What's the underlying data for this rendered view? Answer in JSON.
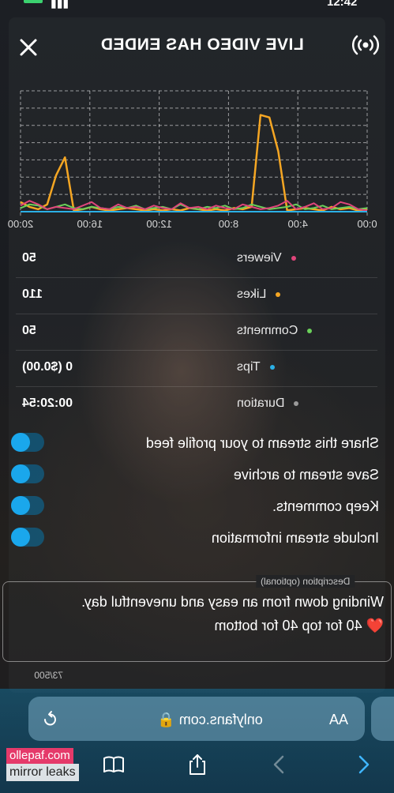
{
  "status_bar": {
    "time": "12:42"
  },
  "header": {
    "title": "LIVE VIDEO HAS ENDED"
  },
  "chart_data": {
    "type": "line",
    "x": [
      "0:00",
      "4:00",
      "8:00",
      "12:00",
      "16:00",
      "20:00"
    ],
    "series": [
      {
        "color": "#f5a623",
        "values": [
          2,
          1,
          3,
          2,
          4,
          1,
          2,
          3,
          2,
          1,
          50,
          78,
          80,
          4,
          2,
          3,
          1,
          2,
          1,
          2,
          3,
          1,
          2,
          1,
          2,
          1,
          2,
          3,
          2,
          1,
          2,
          4,
          2,
          1,
          45,
          30,
          6,
          2,
          4,
          8
        ]
      },
      {
        "color": "#6ad05a",
        "values": [
          3,
          2,
          4,
          3,
          2,
          5,
          3,
          2,
          6,
          4,
          3,
          2,
          4,
          6,
          3,
          2,
          5,
          3,
          4,
          2,
          3,
          6,
          2,
          4,
          3,
          2,
          5,
          3,
          4,
          2,
          3,
          4,
          2,
          3,
          6,
          4,
          2,
          5,
          6,
          3
        ]
      },
      {
        "color": "#e0457b",
        "values": [
          1,
          2,
          6,
          8,
          3,
          2,
          7,
          4,
          2,
          9,
          5,
          3,
          2,
          4,
          6,
          2,
          3,
          5,
          2,
          4,
          3,
          7,
          2,
          3,
          5,
          2,
          4,
          3,
          6,
          2,
          3,
          8,
          5,
          2,
          3,
          4,
          2,
          6,
          9,
          5
        ]
      },
      {
        "color": "#2bb0e6",
        "values": [
          0,
          0,
          0,
          0,
          0,
          0,
          0,
          0,
          0,
          0,
          0,
          0,
          0,
          0,
          0,
          0,
          0,
          0,
          0,
          0,
          0,
          0,
          0,
          0,
          0,
          0,
          0,
          0,
          0,
          0,
          0,
          0,
          0,
          0,
          0,
          0,
          0,
          0,
          0,
          0
        ]
      }
    ],
    "ylim": [
      0,
      100
    ],
    "grid": true
  },
  "stats": [
    {
      "label": "Viewers",
      "value": "50",
      "dot_color": "#e0457b"
    },
    {
      "label": "Likes",
      "value": "110",
      "dot_color": "#f5a623"
    },
    {
      "label": "Comments",
      "value": "50",
      "dot_color": "#6ad05a"
    },
    {
      "label": "Tips",
      "value": "0 ($0.00)",
      "dot_color": "#2bb0e6"
    },
    {
      "label": "Duration",
      "value": "00:20:54",
      "dot_color": "#9a9a9a"
    }
  ],
  "toggles": [
    {
      "label": "Share this stream to your profile feed",
      "on": true
    },
    {
      "label": "Save stream to archive",
      "on": true
    },
    {
      "label": "Keep comments.",
      "on": true
    },
    {
      "label": "Include stream information",
      "on": true
    }
  ],
  "description": {
    "legend": "Description (optional)",
    "line1": "Winding down from an easy and uneventful day.",
    "line2": "❤️ 40 for top 40 for bottom",
    "counter": "73/500"
  },
  "browser": {
    "url": "onlyfans.com",
    "aa_label": "AA",
    "accent": "#1aa7ec"
  },
  "watermark": {
    "line1": "ollepaf.com",
    "line2": "mirror leaks"
  }
}
